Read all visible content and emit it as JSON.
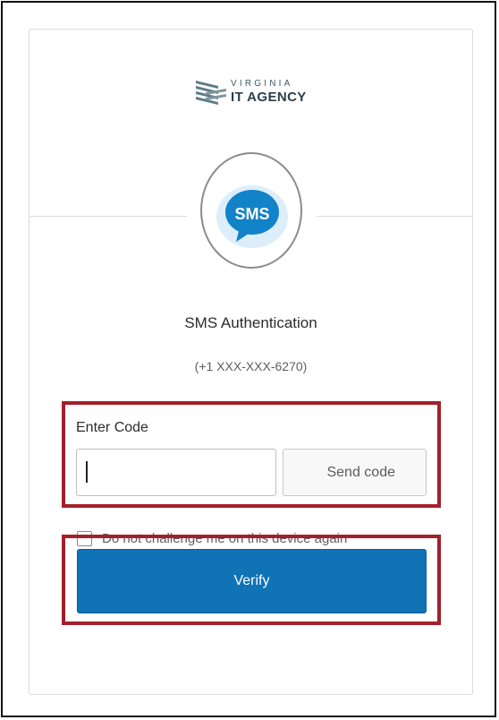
{
  "brand": {
    "line1": "VIRGINIA",
    "line2": "IT AGENCY",
    "mark_color": "#5e7b87"
  },
  "factor_icon": {
    "name": "sms-bubble-icon",
    "label": "SMS",
    "bubble_color": "#1282c9",
    "background_color": "#dceef9"
  },
  "title": "SMS Authentication",
  "phone_number": "(+1 XXX-XXX-6270)",
  "code_field": {
    "label": "Enter Code",
    "value": "",
    "placeholder": ""
  },
  "send_code_label": "Send code",
  "remember_device": {
    "label": "Do not challenge me on this device again",
    "checked": false
  },
  "verify_label": "Verify",
  "colors": {
    "highlight_border": "#a3202b",
    "primary_button": "#0f73b6",
    "frame_border": "#111111"
  }
}
